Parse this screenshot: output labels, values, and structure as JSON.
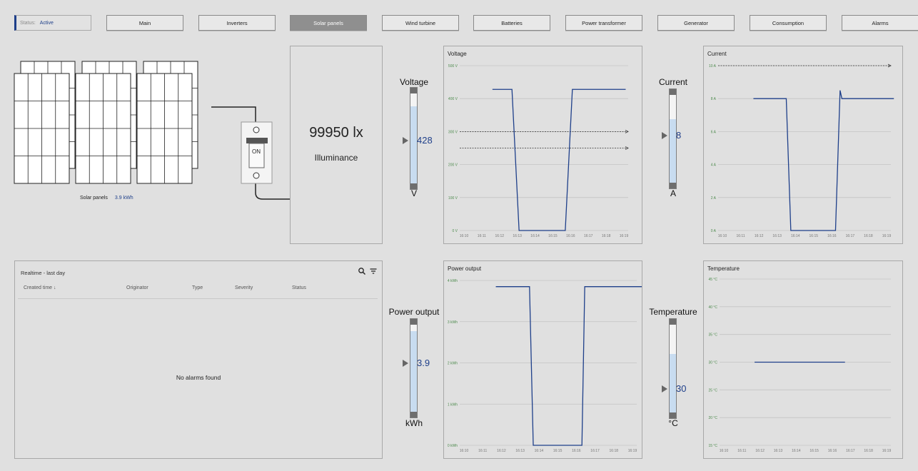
{
  "status": {
    "label": "Status:",
    "value": "Active"
  },
  "nav": [
    {
      "label": "Main"
    },
    {
      "label": "Inverters"
    },
    {
      "label": "Solar panels",
      "active": true
    },
    {
      "label": "Wind turbine"
    },
    {
      "label": "Batteries"
    },
    {
      "label": "Power transformer"
    },
    {
      "label": "Generator"
    },
    {
      "label": "Consumption"
    },
    {
      "label": "Alarms"
    }
  ],
  "diagram": {
    "panels_label": "Solar panels",
    "panels_value": "3.9 kWh",
    "switch_label": "ON"
  },
  "illuminance": {
    "value": "99950 lx",
    "label": "Illuminance"
  },
  "gauges": {
    "voltage": {
      "title": "Voltage",
      "value": "428",
      "unit": "V",
      "level": 0.82
    },
    "current": {
      "title": "Current",
      "value": "8",
      "unit": "A",
      "level": 0.7
    },
    "power": {
      "title": "Power output",
      "value": "3.9",
      "unit": "kWh",
      "level": 0.88
    },
    "temperature": {
      "title": "Temperature",
      "value": "30",
      "unit": "°C",
      "level": 0.65
    }
  },
  "alarms": {
    "title": "Realtime - last day",
    "columns": [
      "Created time",
      "Originator",
      "Type",
      "Severity",
      "Status"
    ],
    "empty": "No alarms found"
  },
  "chart_data": [
    {
      "type": "line",
      "title": "Voltage",
      "x": [
        "16:10",
        "16:11",
        "16:12",
        "16:13",
        "16:14",
        "16:15",
        "16:16",
        "16:17",
        "16:18",
        "16:19"
      ],
      "yticks": [
        "0 V",
        "100 V",
        "200 V",
        "300 V",
        "400 V",
        "500 V"
      ],
      "ylim": [
        0,
        500
      ],
      "series": [
        {
          "points": [
            [
              1.6,
              428
            ],
            [
              2.7,
              428
            ],
            [
              3.1,
              0
            ],
            [
              5.7,
              0
            ],
            [
              6.1,
              428
            ],
            [
              9.1,
              428
            ]
          ]
        }
      ],
      "thresholds": [
        300,
        250
      ]
    },
    {
      "type": "line",
      "title": "Current",
      "x": [
        "16:10",
        "16:11",
        "16:12",
        "16:13",
        "16:14",
        "16:15",
        "16:16",
        "16:17",
        "16:18",
        "16:19"
      ],
      "yticks": [
        "0 A",
        "2 A",
        "4 A",
        "6 A",
        "8 A",
        "10 A"
      ],
      "ylim": [
        0,
        10
      ],
      "series": [
        {
          "points": [
            [
              1.7,
              8
            ],
            [
              3.5,
              8
            ],
            [
              3.75,
              0
            ],
            [
              6.2,
              0
            ],
            [
              6.45,
              8.5
            ],
            [
              6.55,
              8
            ],
            [
              9.4,
              8
            ]
          ]
        }
      ],
      "thresholds": [
        10
      ]
    },
    {
      "type": "line",
      "title": "Power output",
      "x": [
        "16:10",
        "16:11",
        "16:12",
        "16:13",
        "16:14",
        "16:15",
        "16:16",
        "16:17",
        "16:18",
        "16:19"
      ],
      "yticks": [
        "0 kWh",
        "1 kWh",
        "2 kWh",
        "3 kWh",
        "4 kWh"
      ],
      "ylim": [
        0,
        4
      ],
      "series": [
        {
          "points": [
            [
              1.7,
              3.85
            ],
            [
              3.5,
              3.85
            ],
            [
              3.7,
              0
            ],
            [
              6.3,
              0
            ],
            [
              6.45,
              3.85
            ],
            [
              9.5,
              3.85
            ]
          ]
        }
      ],
      "thresholds": []
    },
    {
      "type": "line",
      "title": "Temperature",
      "x": [
        "16:10",
        "16:11",
        "16:12",
        "16:13",
        "16:14",
        "16:15",
        "16:16",
        "16:17",
        "16:18",
        "16:19"
      ],
      "yticks": [
        "15 °C",
        "20 °C",
        "25 °C",
        "30 °C",
        "35 °C",
        "40 °C",
        "45 °C"
      ],
      "ylim": [
        15,
        45
      ],
      "series": [
        {
          "points": [
            [
              1.7,
              30
            ],
            [
              6.7,
              30
            ]
          ]
        }
      ],
      "thresholds": []
    }
  ]
}
